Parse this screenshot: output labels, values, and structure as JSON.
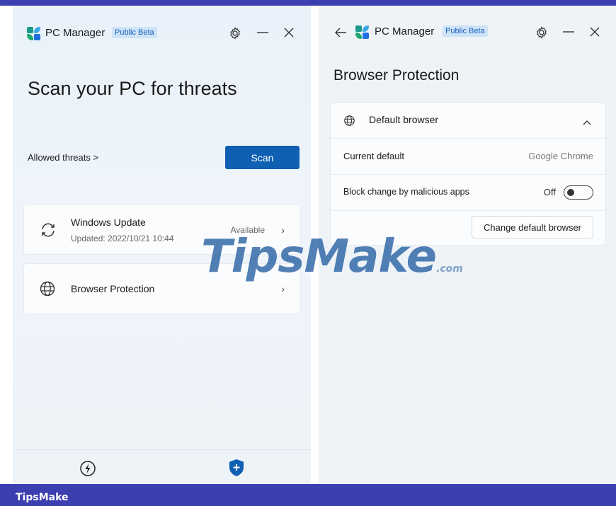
{
  "left": {
    "app_title": "PC Manager",
    "badge": "Public Beta",
    "headline": "Scan your PC for threats",
    "allowed_threats_link": "Allowed threats >",
    "scan_button": "Scan",
    "windows_update": {
      "title": "Windows Update",
      "subtitle": "Updated: 2022/10/21 10:44",
      "status": "Available"
    },
    "browser_protection_item": "Browser Protection"
  },
  "right": {
    "app_title": "PC Manager",
    "badge": "Public Beta",
    "page_title": "Browser Protection",
    "section_header": "Default browser",
    "current_default_label": "Current default",
    "current_default_value": "Google Chrome",
    "block_change_label": "Block change by malicious apps",
    "block_change_state": "Off",
    "change_button": "Change default browser"
  },
  "watermark": {
    "main": "TipsMake",
    "suffix": ".com"
  },
  "footer_brand": "TipsMake",
  "colors": {
    "accent": "#0f5fb3",
    "frame": "#3c3fb0",
    "panel_bg": "#eef3f8"
  },
  "icons": [
    "settings-icon",
    "minimize-icon",
    "close-icon",
    "back-icon",
    "sync-icon",
    "globe-icon",
    "chevron-right-icon",
    "chevron-up-icon",
    "lightning-icon",
    "shield-plus-icon"
  ]
}
